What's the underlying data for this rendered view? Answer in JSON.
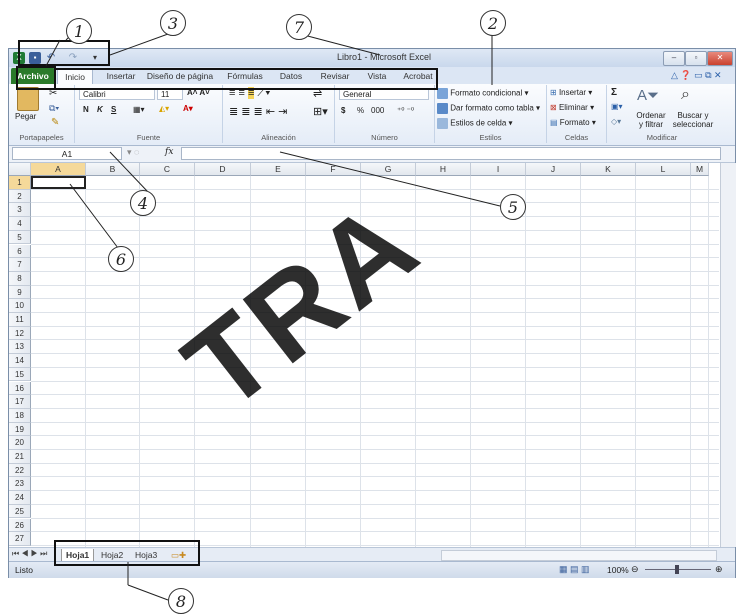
{
  "window": {
    "title": "Libro1 - Microsoft Excel",
    "app_icon": "excel-icon",
    "quick_access": [
      "save-icon",
      "undo-icon",
      "redo-icon",
      "customize-qat-icon"
    ],
    "controls": [
      "minimize-icon",
      "restore-icon",
      "close-icon"
    ]
  },
  "ribbon": {
    "tabs": [
      "Archivo",
      "Inicio",
      "Insertar",
      "Diseño de página",
      "Fórmulas",
      "Datos",
      "Revisar",
      "Vista",
      "Acrobat"
    ],
    "active_tab": "Inicio",
    "clipboard": {
      "paste_label": "Pegar",
      "group_label": "Portapapeles"
    },
    "font": {
      "font_name": "Calibri",
      "font_size": "11",
      "bold": "N",
      "italic": "K",
      "underline": "S",
      "group_label": "Fuente"
    },
    "alignment": {
      "group_label": "Alineación"
    },
    "number": {
      "format": "General",
      "percent": "%",
      "thousands": "000",
      "currency": "$",
      "group_label": "Número"
    },
    "styles": {
      "conditional": "Formato condicional",
      "table": "Dar formato como tabla",
      "cell_styles": "Estilos de celda",
      "group_label": "Estilos"
    },
    "cells": {
      "insert": "Insertar",
      "delete": "Eliminar",
      "format": "Formato",
      "group_label": "Celdas"
    },
    "editing": {
      "sigma": "Σ",
      "sort_line1": "Ordenar",
      "sort_line2": "y filtrar",
      "find_line1": "Buscar y",
      "find_line2": "seleccionar",
      "group_label": "Modificar"
    }
  },
  "formula_bar": {
    "name_box": "A1",
    "fx": "fx",
    "value": ""
  },
  "grid": {
    "columns": [
      "A",
      "B",
      "C",
      "D",
      "E",
      "F",
      "G",
      "H",
      "I",
      "J",
      "K",
      "L",
      "M"
    ],
    "rows": [
      "1",
      "2",
      "3",
      "4",
      "5",
      "6",
      "7",
      "8",
      "9",
      "10",
      "11",
      "12",
      "13",
      "14",
      "15",
      "16",
      "17",
      "18",
      "19",
      "20",
      "21",
      "22",
      "23",
      "24",
      "25",
      "26",
      "27"
    ],
    "active_cell": "A1"
  },
  "sheets": {
    "tabs": [
      "Hoja1",
      "Hoja2",
      "Hoja3"
    ],
    "active": "Hoja1"
  },
  "status": {
    "mode": "Listo",
    "zoom": "100%"
  },
  "annotations": [
    "1",
    "2",
    "3",
    "4",
    "5",
    "6",
    "7",
    "8"
  ],
  "watermark": "TRA"
}
